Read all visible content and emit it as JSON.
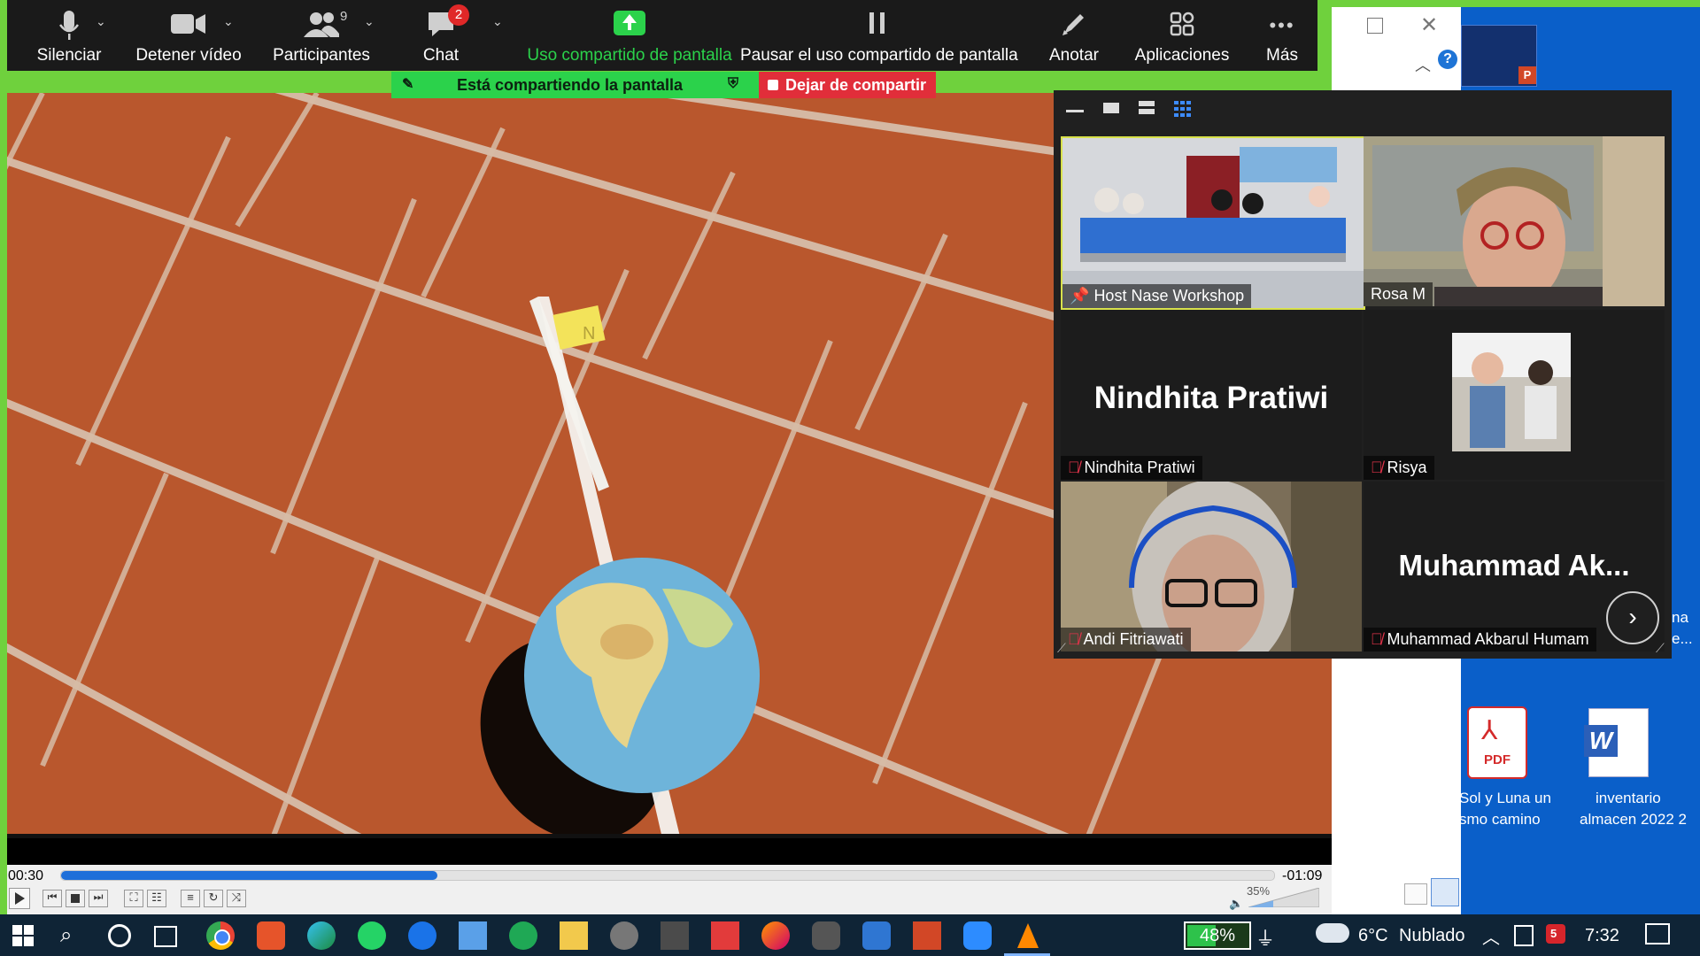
{
  "zoom_toolbar": {
    "mute_label": "Silenciar",
    "stop_video_label": "Detener vídeo",
    "participants_label": "Participantes",
    "participants_count": "9",
    "chat_label": "Chat",
    "chat_badge": "2",
    "share_label": "Uso compartido de pantalla",
    "pause_share_label": "Pausar el uso compartido de pantalla",
    "annotate_label": "Anotar",
    "apps_label": "Aplicaciones",
    "more_label": "Más"
  },
  "share_banner": {
    "status_text": "Está compartiendo la pantalla",
    "stop_label": "Dejar de compartir"
  },
  "gallery": {
    "participants": [
      {
        "name": "Host Nase Workshop"
      },
      {
        "name": "Rosa M"
      },
      {
        "name": "Nindhita Pratiwi",
        "big_name": "Nindhita Pratiwi"
      },
      {
        "name": "Risya"
      },
      {
        "name": "Andi Fitriawati"
      },
      {
        "name": "Muhammad Akbarul Humam",
        "big_name": "Muhammad  Ak..."
      }
    ]
  },
  "player": {
    "time_elapsed": "00:30",
    "time_remaining": "-01:09",
    "volume": "35%",
    "progress": 0.31,
    "volume_level": 0.35
  },
  "video_scene": {
    "note_letter": "N"
  },
  "desktop": {
    "icons": [
      {
        "label_line1": "Sol y Luna un",
        "label_line2": "smo camino",
        "type_text": "PDF"
      },
      {
        "label_line1": "inventario",
        "label_line2": "almacen 2022  2",
        "type_text": "W"
      }
    ],
    "partial_text_1": "na",
    "partial_text_2": "e..."
  },
  "taskbar": {
    "battery": "48%",
    "temperature": "6°C",
    "weather": "Nublado",
    "time": "7:32",
    "notif_count": "5"
  },
  "colors": {
    "zoom_dark": "#1a1a1a",
    "share_green": "#2bd24b",
    "stop_red": "#e12e3a",
    "desktop_blue": "#0a5fc9",
    "taskbar": "#0f2436",
    "vlc_progress": "#1e6fd9"
  }
}
